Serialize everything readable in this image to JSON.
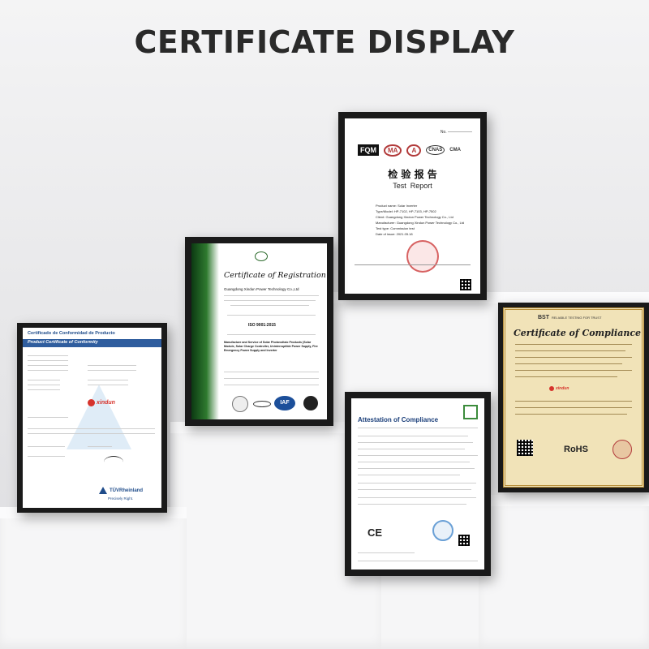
{
  "heading": "CERTIFICATE DISPLAY",
  "cert_product": {
    "title_es": "Certificado de Conformidad de Producto",
    "title_en": "Product Certificate of Conformity",
    "brand": "xindun",
    "footer_brand": "TÜVRheinland",
    "footer_tagline": "Precisely Right."
  },
  "cert_registration": {
    "title": "Certificate of Registration",
    "company": "Guangdong Xindun Power Technology Co.,Ltd",
    "standard": "ISO 9001:2015",
    "scope": "Manufacture and Service of Solar Photovoltaic Products (Solar Module, Solar Charge Controller, Uninterruptible Power Supply, Fire Emergency Power Supply and Inverter"
  },
  "cert_test": {
    "logos": [
      "FQM",
      "MA",
      "A",
      "CNAS",
      "CMA"
    ],
    "title_cn": "检 验 报 告",
    "title_en": "Test  Report",
    "fields": [
      {
        "label": "Product name:",
        "value": "Solar Inverter"
      },
      {
        "label": "Type/Model:",
        "value": "HP-7102, HP-7103, HP-7502"
      },
      {
        "label": "Client:",
        "value": "Guangdong Xindun Power Technology Co., Ltd"
      },
      {
        "label": "Manufacturer:",
        "value": "Guangdong Xindun Power Technology Co., Ltd"
      },
      {
        "label": "Test type:",
        "value": "Commission test"
      },
      {
        "label": "Date of issue:",
        "value": "2021.05.18"
      }
    ]
  },
  "cert_compliance_gold": {
    "brand": "BST",
    "brand_tagline": "RELIABLE TESTING FOR TRUST",
    "title": "Certificate of Compliance",
    "brand_mark": "xindun",
    "rohs": "RoHS"
  },
  "cert_attestation": {
    "title": "Attestation of Compliance",
    "ce": "CE"
  }
}
